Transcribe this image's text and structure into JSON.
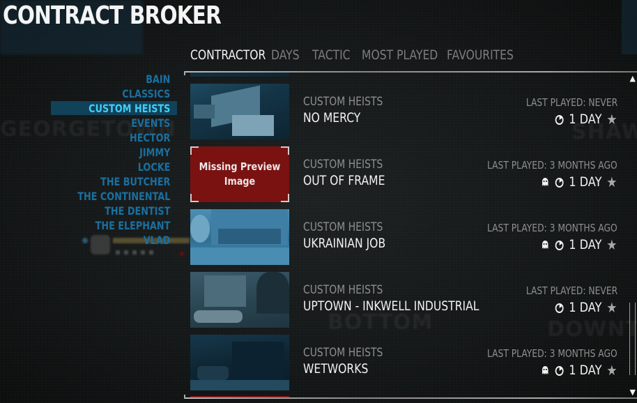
{
  "header": {
    "title": "CONTRACT BROKER"
  },
  "tabs": [
    {
      "label": "CONTRACTOR",
      "active": true
    },
    {
      "label": "DAYS",
      "active": false
    },
    {
      "label": "TACTIC",
      "active": false
    },
    {
      "label": "MOST PLAYED",
      "active": false
    },
    {
      "label": "FAVOURITES",
      "active": false
    }
  ],
  "sidebar": {
    "items": [
      {
        "label": "BAIN"
      },
      {
        "label": "CLASSICS"
      },
      {
        "label": "CUSTOM HEISTS",
        "active": true
      },
      {
        "label": "EVENTS"
      },
      {
        "label": "HECTOR"
      },
      {
        "label": "JIMMY"
      },
      {
        "label": "LOCKE"
      },
      {
        "label": "THE BUTCHER"
      },
      {
        "label": "THE CONTINENTAL"
      },
      {
        "label": "THE DENTIST"
      },
      {
        "label": "THE ELEPHANT"
      },
      {
        "label": "VLAD"
      }
    ]
  },
  "missing_preview_label": "Missing Preview Image",
  "heists": [
    {
      "category": "CUSTOM HEISTS",
      "name": "NO MERCY",
      "last_played": "LAST PLAYED: NEVER",
      "stealth_icon": false,
      "timer_icon": "timer-icon",
      "days": "1 DAY",
      "favourite_icon": "star-icon",
      "preview": "dark"
    },
    {
      "category": "CUSTOM HEISTS",
      "name": "OUT OF FRAME",
      "last_played": "LAST PLAYED: 3 MONTHS AGO",
      "stealth_icon": true,
      "timer_icon": "timer-icon",
      "days": "1 DAY",
      "favourite_icon": "star-icon",
      "preview": "missing"
    },
    {
      "category": "CUSTOM HEISTS",
      "name": "UKRAINIAN JOB",
      "last_played": "LAST PLAYED: 3 MONTHS AGO",
      "stealth_icon": true,
      "timer_icon": "timer-icon",
      "days": "1 DAY",
      "favourite_icon": "star-icon",
      "preview": "bright"
    },
    {
      "category": "CUSTOM HEISTS",
      "name": "UPTOWN - INKWELL INDUSTRIAL",
      "last_played": "LAST PLAYED: NEVER",
      "stealth_icon": false,
      "timer_icon": "timer-icon",
      "days": "1 DAY",
      "favourite_icon": "star-icon",
      "preview": "grey"
    },
    {
      "category": "CUSTOM HEISTS",
      "name": "WETWORKS",
      "last_played": "LAST PLAYED: 3 MONTHS AGO",
      "stealth_icon": true,
      "timer_icon": "timer-icon",
      "days": "1 DAY",
      "favourite_icon": "star-icon",
      "preview": "night"
    }
  ],
  "scroll": {
    "up_glyph": "▲",
    "down_glyph": "▼"
  },
  "background_words": [
    "GEORGETOWN",
    "SHAW",
    "BOTTOM",
    "DOWNTO"
  ],
  "colors": {
    "sidebar_text": "#1a6f9f",
    "sidebar_active": "#3fd0f5",
    "sidebar_highlight": "#12415a",
    "missing_preview_bg": "#7a1212"
  }
}
